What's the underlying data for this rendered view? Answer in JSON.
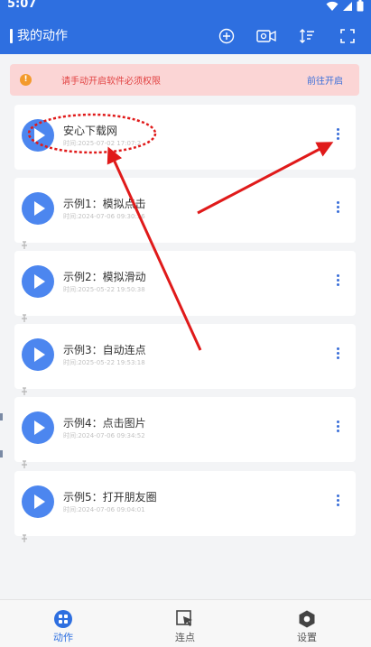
{
  "status_bar": {
    "time": "5:07"
  },
  "header": {
    "title": "我的动作"
  },
  "notice": {
    "text": "请手动开启软件必须权限",
    "link": "前往开启"
  },
  "actions": [
    {
      "title": "安心下载网",
      "time": "时间:2025-07-02 17:07:2"
    },
    {
      "title": "示例1：模拟点击",
      "time": "时间:2024-07-06 09:30:36"
    },
    {
      "title": "示例2：模拟滑动",
      "time": "时间:2025-05-22 19:50:38"
    },
    {
      "title": "示例3：自动连点",
      "time": "时间:2025-05-22 19:53:18"
    },
    {
      "title": "示例4：点击图片",
      "time": "时间:2024-07-06 09:34:52"
    },
    {
      "title": "示例5：打开朋友圈",
      "time": "时间:2024-07-06 09:04:01"
    }
  ],
  "bottom_nav": [
    {
      "label": "动作",
      "icon": "grid-icon",
      "active": true
    },
    {
      "label": "连点",
      "icon": "cursor-click-icon",
      "active": false
    },
    {
      "label": "设置",
      "icon": "settings-hexagon-icon",
      "active": false
    }
  ],
  "colors": {
    "primary": "#2e6fe0",
    "play_button": "#4c86ef",
    "notice_bg": "#fbd5d5",
    "notice_text": "#e24343",
    "annotation": "#e01a1a"
  }
}
